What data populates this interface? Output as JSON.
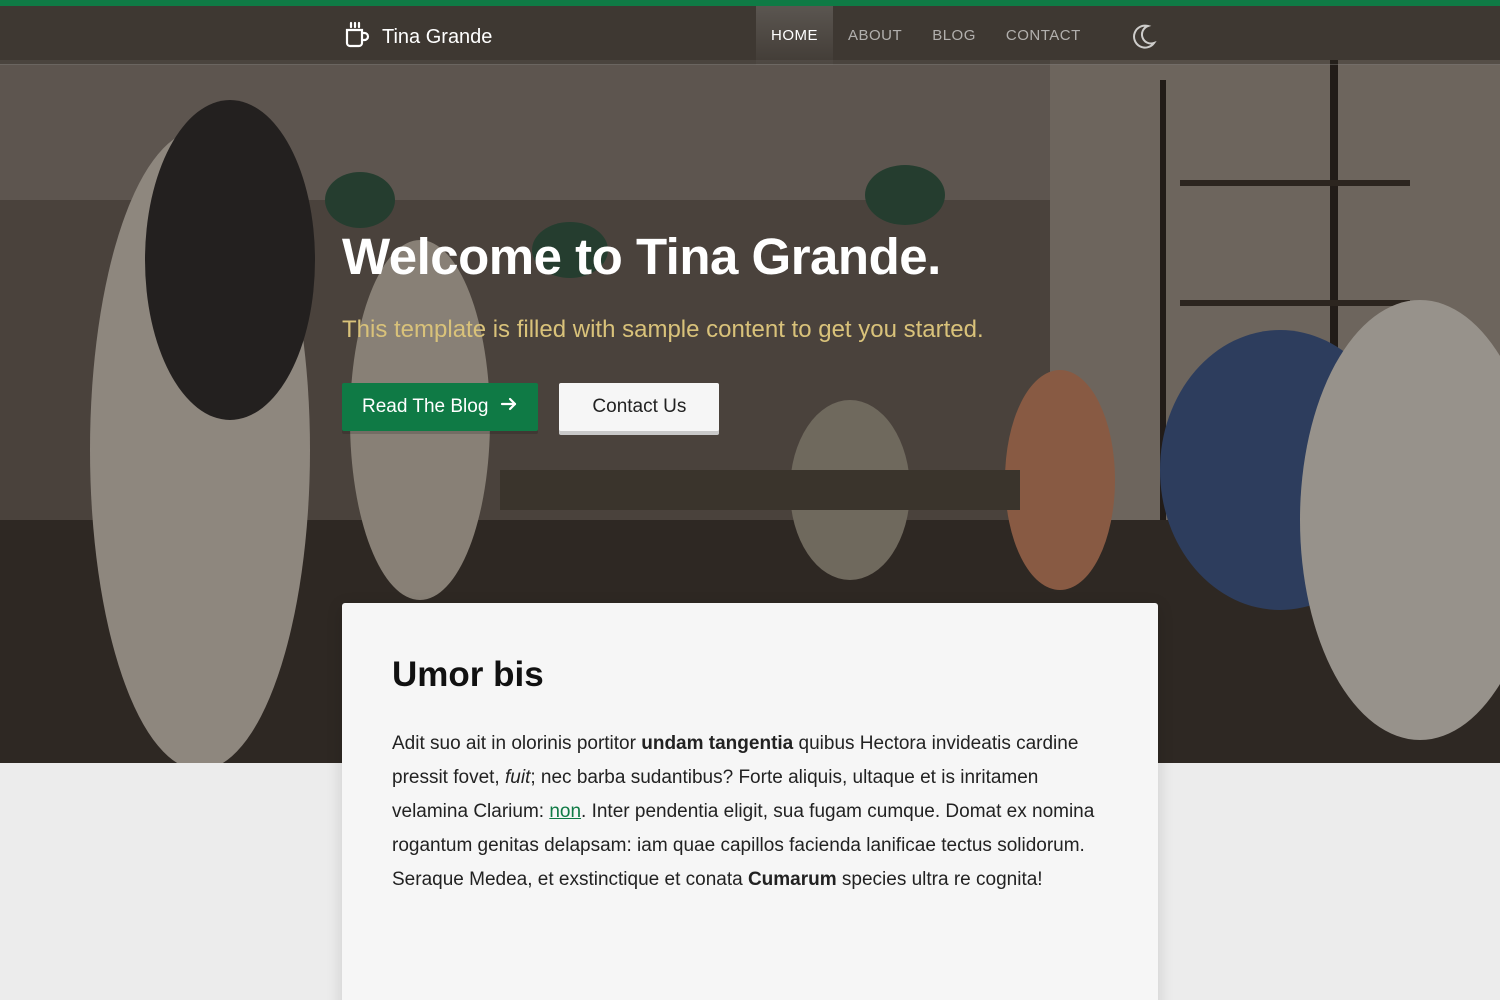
{
  "colors": {
    "accent": "#0f7a45",
    "subtitle": "#d9c27a",
    "card_bg": "#f6f6f6",
    "page_bg": "#ececec"
  },
  "navbar": {
    "brand": {
      "icon": "coffee-cup-icon",
      "name": "Tina Grande"
    },
    "items": [
      {
        "label": "HOME",
        "active": true
      },
      {
        "label": "ABOUT",
        "active": false
      },
      {
        "label": "BLOG",
        "active": false
      },
      {
        "label": "CONTACT",
        "active": false
      }
    ],
    "theme_toggle_icon": "moon-icon"
  },
  "hero": {
    "title": "Welcome to Tina Grande.",
    "subtitle": "This template is filled with sample content to get you started.",
    "primary_button": {
      "label": "Read The Blog",
      "icon": "arrow-right-icon"
    },
    "secondary_button": {
      "label": "Contact Us"
    }
  },
  "content": {
    "heading": "Umor bis",
    "paragraph": {
      "t1": "Adit suo ait in olorinis portitor ",
      "b1": "undam tangentia",
      "t2": " quibus Hectora invideatis cardine pressit fovet, ",
      "i1": "fuit",
      "t3": "; nec barba sudantibus? Forte aliquis, ultaque et is inritamen velamina Clarium: ",
      "link": "non",
      "t4": ". Inter pendentia eligit, sua fugam cumque. Domat ex nomina rogantum genitas delapsam: iam quae capillos facienda lanificae tectus solidorum. Seraque Medea, et exstinctique et conata ",
      "b2": "Cumarum",
      "t5": " species ultra re cognita!"
    }
  }
}
